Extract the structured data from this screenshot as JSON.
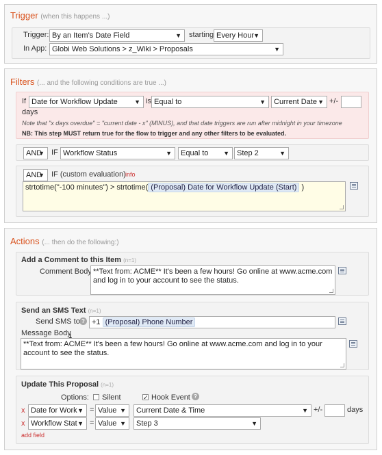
{
  "trigger": {
    "title": "Trigger",
    "hint": "(when this happens ...)",
    "trigger_label": "Trigger:",
    "trigger_value": "By an Item's Date Field",
    "starting_at_label": "starting at",
    "starting_at_value": "Every Hour",
    "in_app_label": "In App:",
    "in_app_value": "Globi Web Solutions > z_Wiki > Proposals"
  },
  "filters": {
    "title": "Filters",
    "hint": "(... and the following conditions are true ...)",
    "date_filter": {
      "if_label": "If",
      "field_value": "Date for Workflow Update",
      "is_label": "is",
      "operator_value": "Equal to",
      "compare_value": "Current Date",
      "plus_minus_label": "+/-",
      "offset_value": "",
      "days_label": "days",
      "note": "Note that \"x days overdue\" = \"current date - x\" (MINUS), and that date triggers are run after midnight in your timezone",
      "nb": "NB: This step MUST return true for the flow to trigger and any other filters to be evaluated."
    },
    "status_filter": {
      "join_value": "AND",
      "if_label": "IF",
      "field_value": "Workflow Status",
      "operator_value": "Equal to",
      "compare_value": "Step 2"
    },
    "custom_filter": {
      "join_value": "AND",
      "if_label": "IF (custom evaluation)",
      "info_label": "info",
      "code_prefix": "strtotime(\"-100 minutes\") > strtotime(",
      "code_token": "(Proposal) Date for Workflow Update (Start)",
      "code_suffix": ")"
    }
  },
  "actions": {
    "title": "Actions",
    "hint": "(... then do the following:)",
    "comment": {
      "title": "Add a Comment to this Item",
      "count": "(n=1)",
      "body_label": "Comment Body",
      "body_value": "**Text from: ACME** It's been a few hours! Go online at www.acme.com and log in to your account to see the status."
    },
    "sms": {
      "title": "Send an SMS Text",
      "count": "(n=1)",
      "send_to_label": "Send SMS to",
      "send_to_prefix": "+1",
      "send_to_token": "(Proposal) Phone Number",
      "message_label": "Message Body",
      "message_marker": "1",
      "message_value": "**Text from: ACME** It's been a few hours! Go online at www.acme.com and log in to your account to see the status."
    },
    "update": {
      "title": "Update This Proposal",
      "count": "(n=1)",
      "options_label": "Options:",
      "silent_label": "Silent",
      "silent_checked": false,
      "hook_label": "Hook Event",
      "hook_checked": true,
      "rows": [
        {
          "remove": "x",
          "field": "Date for Work",
          "equals": "=",
          "mode": "Value",
          "value": "Current Date & Time",
          "plus_minus": "+/-",
          "offset": "",
          "days": "days"
        },
        {
          "remove": "x",
          "field": "Workflow Stat",
          "equals": "=",
          "mode": "Value",
          "value": "Step 3"
        }
      ],
      "add_field": "add field"
    }
  }
}
